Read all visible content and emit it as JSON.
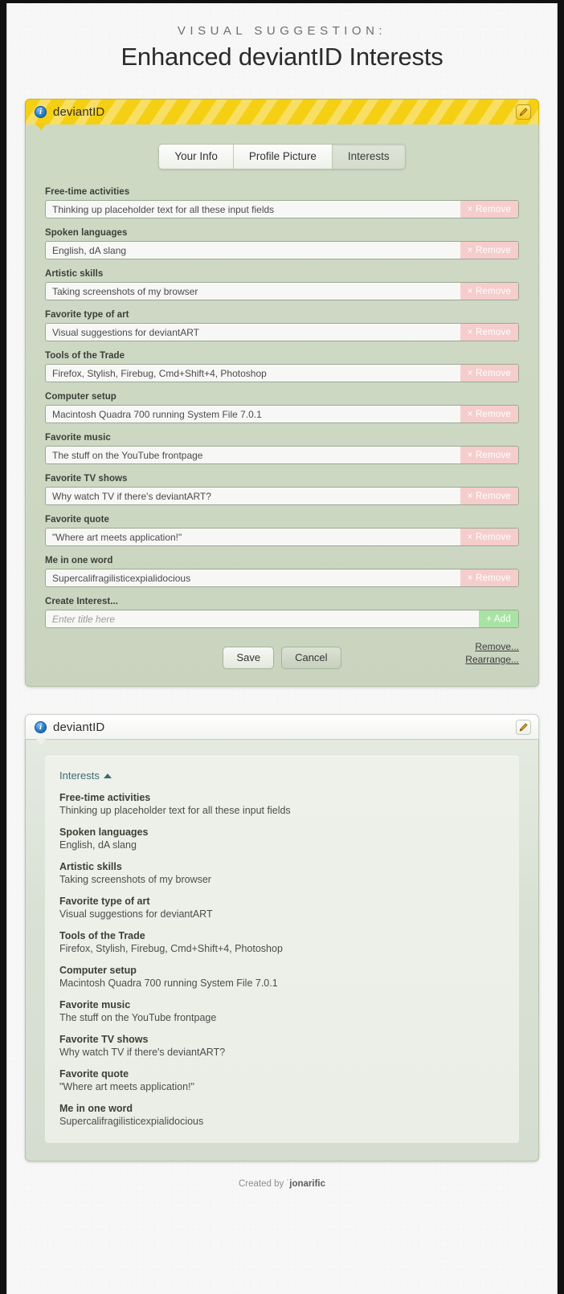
{
  "page": {
    "kicker": "VISUAL SUGGESTION:",
    "headline": "Enhanced deviantID Interests",
    "credit_prefix": "Created by ˙",
    "credit_name": "jonarific"
  },
  "colors": {
    "header_yellow": "#f5cf13",
    "panel_green": "#ced9c4",
    "remove_pink": "#f6cdcd",
    "add_green": "#a9e3a4",
    "link_teal": "#3d6b73"
  },
  "edit_panel": {
    "title": "deviantID",
    "info_glyph": "i",
    "edit_icon": "pencil-icon",
    "tabs": [
      {
        "label": "Your Info",
        "active": false
      },
      {
        "label": "Profile Picture",
        "active": false
      },
      {
        "label": "Interests",
        "active": true
      }
    ],
    "fields": [
      {
        "label": "Free-time activities",
        "value": "Thinking up placeholder text for all these input fields",
        "button": "× Remove"
      },
      {
        "label": "Spoken languages",
        "value": "English, dA slang",
        "button": "× Remove"
      },
      {
        "label": "Artistic skills",
        "value": "Taking screenshots of my browser",
        "button": "× Remove"
      },
      {
        "label": "Favorite type of art",
        "value": "Visual suggestions for deviantART",
        "button": "× Remove"
      },
      {
        "label": "Tools of the Trade",
        "value": "Firefox, Stylish, Firebug, Cmd+Shift+4, Photoshop",
        "button": "× Remove"
      },
      {
        "label": "Computer setup",
        "value": "Macintosh Quadra 700 running System File 7.0.1",
        "button": "× Remove"
      },
      {
        "label": "Favorite music",
        "value": "The stuff on the YouTube frontpage",
        "button": "× Remove"
      },
      {
        "label": "Favorite TV shows",
        "value": "Why watch TV if there's deviantART?",
        "button": "× Remove"
      },
      {
        "label": "Favorite quote",
        "value": "\"Where art meets application!\"",
        "button": "× Remove"
      },
      {
        "label": "Me in one word",
        "value": "Supercalifragilisticexpialidocious",
        "button": "× Remove"
      }
    ],
    "create": {
      "label": "Create Interest...",
      "placeholder": "Enter title here",
      "button": "+ Add"
    },
    "save_label": "Save",
    "cancel_label": "Cancel",
    "remove_link": "Remove...",
    "rearrange_link": "Rearrange..."
  },
  "view_panel": {
    "title": "deviantID",
    "info_glyph": "i",
    "edit_icon": "pencil-icon",
    "section_label": "Interests",
    "items": [
      {
        "title": "Free-time activities",
        "value": "Thinking up placeholder text for all these input fields"
      },
      {
        "title": "Spoken languages",
        "value": "English, dA slang"
      },
      {
        "title": "Artistic skills",
        "value": "Taking screenshots of my browser"
      },
      {
        "title": "Favorite type of art",
        "value": "Visual suggestions for deviantART"
      },
      {
        "title": "Tools of the Trade",
        "value": "Firefox, Stylish, Firebug, Cmd+Shift+4, Photoshop"
      },
      {
        "title": "Computer setup",
        "value": "Macintosh Quadra 700 running System File 7.0.1"
      },
      {
        "title": "Favorite music",
        "value": "The stuff on the YouTube frontpage"
      },
      {
        "title": "Favorite TV shows",
        "value": "Why watch TV if there's deviantART?"
      },
      {
        "title": "Favorite quote",
        "value": "\"Where art meets application!\""
      },
      {
        "title": "Me in one word",
        "value": "Supercalifragilisticexpialidocious"
      }
    ]
  }
}
